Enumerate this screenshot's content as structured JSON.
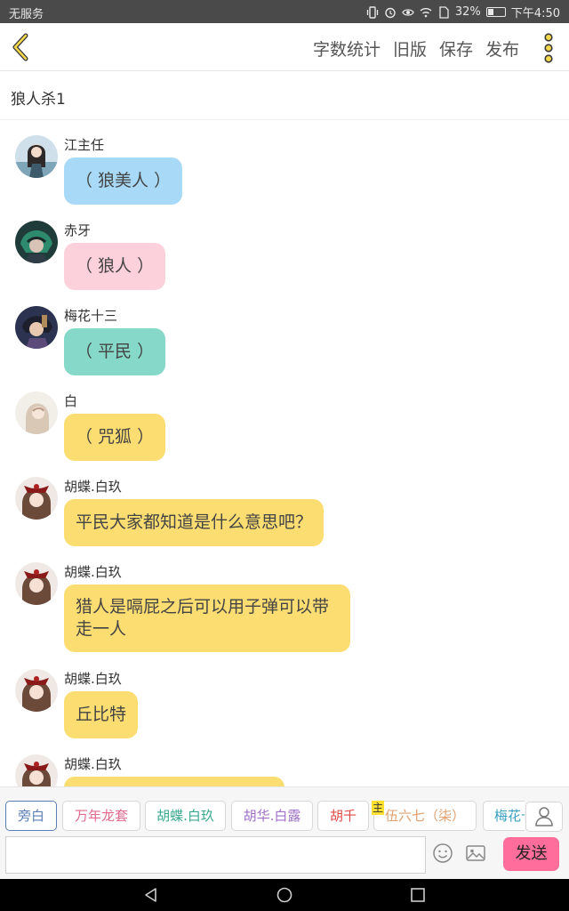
{
  "status_bar": {
    "carrier": "无服务",
    "battery": "32%",
    "battery_level": 0.32,
    "time": "下午4:50"
  },
  "toolbar": {
    "word_count": "字数统计",
    "old_version": "旧版",
    "save": "保存",
    "publish": "发布"
  },
  "title": "狼人杀1",
  "colors": {
    "blue_bubble": "#a8daf8",
    "pink_bubble": "#fdd1dc",
    "teal_bubble": "#86d8c8",
    "yellow_bubble": "#fcdd72",
    "send_button": "#ff6d9c",
    "selected_role": "#5b7fb5"
  },
  "messages": [
    {
      "name": "江主任",
      "text": "（ 狼美人 ）",
      "color": "#a8daf8",
      "avatar": "avatar-jiang"
    },
    {
      "name": "赤牙",
      "text": "（ 狼人 ）",
      "color": "#fdd1dc",
      "avatar": "avatar-chiya"
    },
    {
      "name": "梅花十三",
      "text": "（ 平民 ）",
      "color": "#86d8c8",
      "avatar": "avatar-meihua"
    },
    {
      "name": "白",
      "text": "（ 咒狐 ）",
      "color": "#fcdd72",
      "avatar": "avatar-bai"
    },
    {
      "name": "胡蝶.白玖",
      "text": "平民大家都知道是什么意思吧？",
      "color": "#fcdd72",
      "avatar": "avatar-hudie"
    },
    {
      "name": "胡蝶.白玖",
      "text": "猎人是嗝屁之后可以用子弹可以带走一人",
      "color": "#fcdd72",
      "avatar": "avatar-hudie"
    },
    {
      "name": "胡蝶.白玖",
      "text": "丘比特",
      "color": "#fcdd72",
      "avatar": "avatar-hudie"
    },
    {
      "name": "胡蝶.白玖",
      "text": "",
      "color": "#fcdd72",
      "avatar": "avatar-hudie"
    }
  ],
  "roles": [
    {
      "label": "旁白",
      "color": "#5b7fb5",
      "selected": true
    },
    {
      "label": "万年龙套",
      "color": "#e06a8c"
    },
    {
      "label": "胡蝶.白玖",
      "color": "#3aa890"
    },
    {
      "label": "胡华.白露",
      "color": "#a070c8"
    },
    {
      "label": "胡千",
      "color": "#e04848"
    },
    {
      "label": "伍六七（柒）",
      "color": "#e0a070",
      "badge": "主"
    },
    {
      "label": "梅花十三",
      "color": "#3aa0c0"
    }
  ],
  "input": {
    "value": "",
    "placeholder": ""
  },
  "send_label": "发送"
}
